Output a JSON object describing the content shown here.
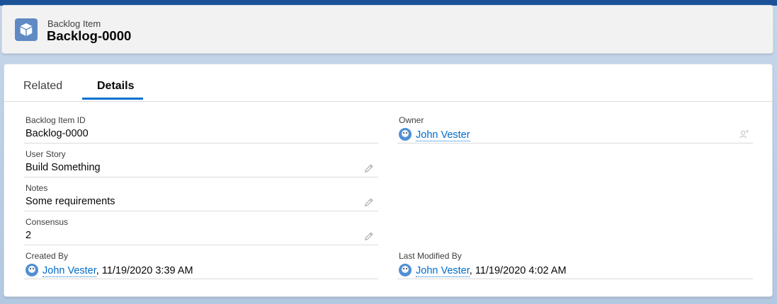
{
  "header": {
    "object_label": "Backlog Item",
    "record_title": "Backlog-0000",
    "icon": "cube-icon",
    "icon_color": "#5f8ac4"
  },
  "tabs": [
    {
      "label": "Related",
      "active": false
    },
    {
      "label": "Details",
      "active": true
    }
  ],
  "fields": {
    "backlog_item_id": {
      "label": "Backlog Item ID",
      "value": "Backlog-0000"
    },
    "owner": {
      "label": "Owner",
      "value": "John Vester"
    },
    "user_story": {
      "label": "User Story",
      "value": "Build Something"
    },
    "notes": {
      "label": "Notes",
      "value": "Some requirements"
    },
    "consensus": {
      "label": "Consensus",
      "value": "2"
    },
    "created_by": {
      "label": "Created By",
      "user": "John Vester",
      "timestamp": ", 11/19/2020 3:39 AM"
    },
    "last_modified_by": {
      "label": "Last Modified By",
      "user": "John Vester",
      "timestamp": ", 11/19/2020 4:02 AM"
    }
  },
  "colors": {
    "brand_bar": "#1b5297",
    "link": "#006dcc",
    "active_tab_underline": "#0070d2"
  }
}
